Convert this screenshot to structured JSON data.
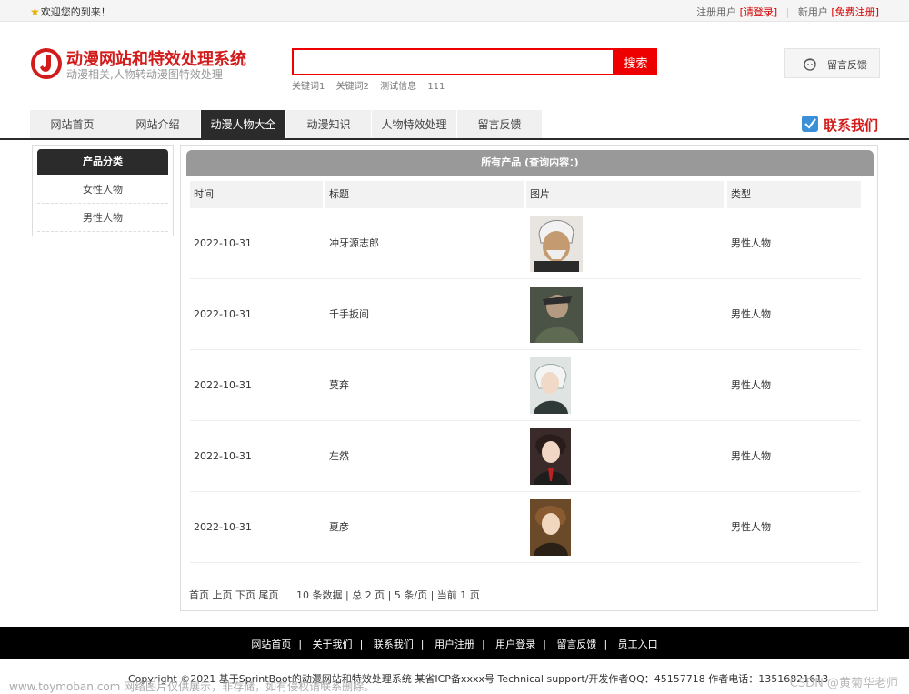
{
  "topbar": {
    "welcome": "欢迎您的到来！",
    "register_prefix": "注册用户",
    "login_link": "[请登录]",
    "new_user_prefix": "新用户",
    "free_register_link": "[免费注册]"
  },
  "header": {
    "title": "动漫网站和特效处理系统",
    "subtitle": "动漫相关,人物转动漫图特效处理",
    "search_placeholder": "",
    "search_button": "搜索",
    "keywords": [
      "关键词1",
      "关键词2",
      "测试信息",
      "111"
    ],
    "feedback_button": "留言反馈"
  },
  "nav": {
    "tabs": [
      "网站首页",
      "网站介绍",
      "动漫人物大全",
      "动漫知识",
      "人物特效处理",
      "留言反馈"
    ],
    "active_index": 2,
    "contact": "联系我们"
  },
  "sidebar": {
    "title": "产品分类",
    "items": [
      "女性人物",
      "男性人物"
    ]
  },
  "main": {
    "title": "所有产品 (查询内容：)",
    "columns": [
      "时间",
      "标题",
      "图片",
      "类型"
    ],
    "rows": [
      {
        "date": "2022-10-31",
        "title": "冲牙源志郎",
        "type": "男性人物"
      },
      {
        "date": "2022-10-31",
        "title": "千手扳间",
        "type": "男性人物"
      },
      {
        "date": "2022-10-31",
        "title": "莫弃",
        "type": "男性人物"
      },
      {
        "date": "2022-10-31",
        "title": "左然",
        "type": "男性人物"
      },
      {
        "date": "2022-10-31",
        "title": "夏彦",
        "type": "男性人物"
      }
    ],
    "pager": {
      "first": "首页",
      "prev": "上页",
      "next": "下页",
      "last": "尾页",
      "summary": "10 条数据 | 总 2 页 | 5 条/页 | 当前 1 页"
    }
  },
  "footer": {
    "links": [
      "网站首页",
      "关于我们",
      "联系我们",
      "用户注册",
      "用户登录",
      "留言反馈",
      "员工入口"
    ],
    "copyright": "Copyright ©2021 基于SprintBoot的动漫网站和特效处理系统    某省ICP备xxxx号    Technical support/开发作者QQ：45157718    作者电话：13516821613",
    "watermark_left": "www.toymoban.com 网络图片仅供展示，非存储，如有侵权请联系删除。",
    "watermark_right": "CSDN @黄菊华老师"
  },
  "colors": {
    "brand_red": "#d21c1c",
    "search_red": "#ee0000",
    "nav_dark": "#2b2b2b",
    "panel_head_gray": "#999999"
  }
}
